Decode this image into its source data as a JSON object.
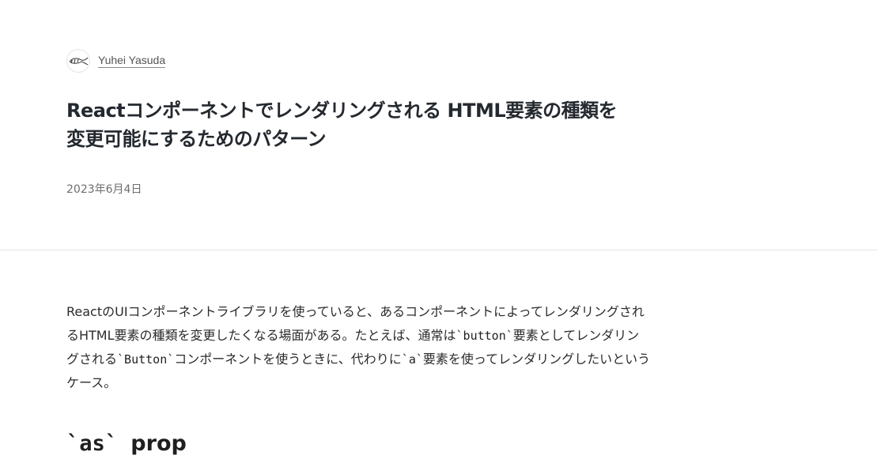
{
  "author": {
    "avatar_icon": "fish-sketch-icon",
    "name": "Yuhei Yasuda"
  },
  "article": {
    "title_line1": "Reactコンポーネントでレンダリングされる HTML要素の種類を",
    "title_line2": "変更可能にするためのパターン",
    "date": "2023年6月4日",
    "intro": {
      "t1": "ReactのUIコンポーネントライブラリを使っていると、あるコンポーネントによってレンダリングされるHTML要素の種類を変更したくなる場面がある。たとえば、通常は",
      "c1": "`button`",
      "t2": "要素としてレンダリングされる",
      "c2": "`Button`",
      "t3": "コンポーネントを使うときに、代わりに",
      "c3": "`a`",
      "t4": "要素を使ってレンダリングしたいというケース。"
    },
    "section_heading_code": "`as`",
    "section_heading_word": "prop"
  }
}
